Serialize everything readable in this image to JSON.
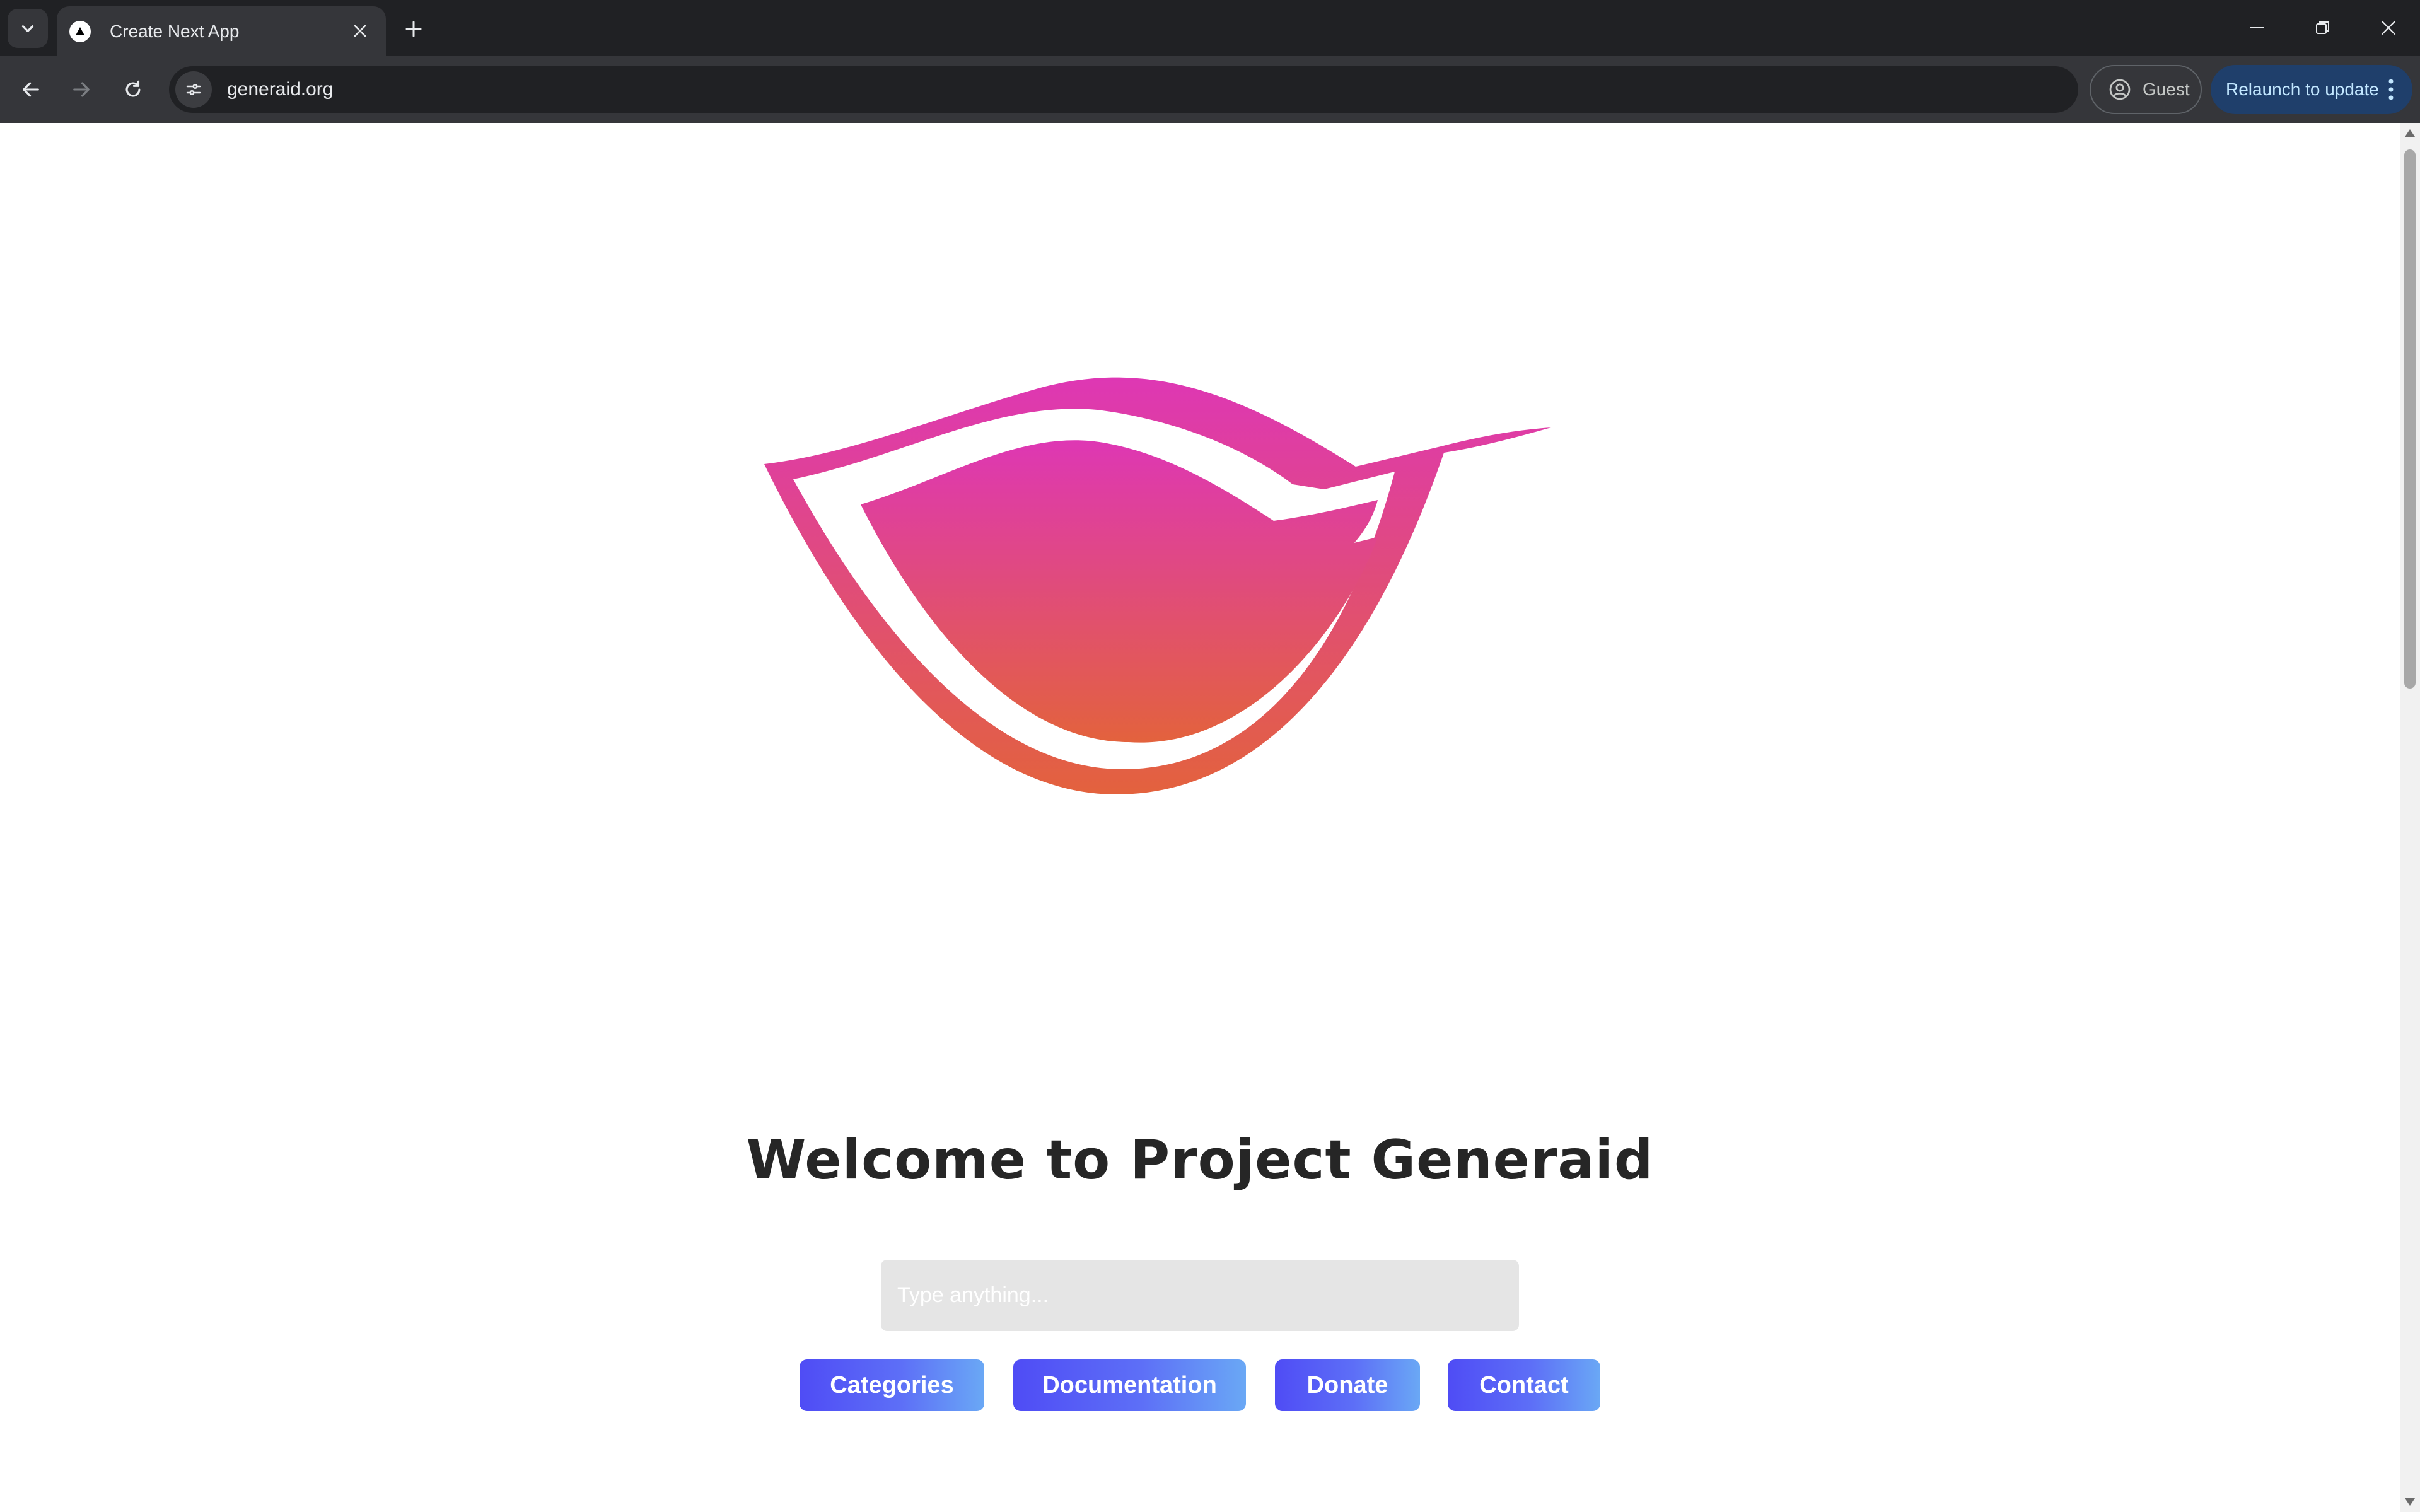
{
  "browser": {
    "tab_title": "Create Next App",
    "url": "generaid.org",
    "profile_label": "Guest",
    "update_label": "Relaunch to update",
    "icons": {
      "tab_list": "chevron-down-icon",
      "favicon": "nextjs-triangle-icon",
      "tab_close": "close-icon",
      "new_tab": "plus-icon",
      "minimize": "minimize-icon",
      "restore": "restore-icon",
      "close_window": "close-icon",
      "back": "arrow-left-icon",
      "forward": "arrow-right-icon",
      "reload": "reload-icon",
      "site_info": "tune-icon",
      "profile": "person-circle-icon",
      "menu": "kebab-menu-icon"
    }
  },
  "page": {
    "logo_icon": "leaf-logo-icon",
    "logo_colors": {
      "top": "#de37b4",
      "bottom": "#e3623d"
    },
    "title": "Welcome to Project Generaid",
    "search_placeholder": "Type anything...",
    "buttons": {
      "categories": "Categories",
      "documentation": "Documentation",
      "donate": "Donate",
      "contact": "Contact"
    },
    "button_gradient": {
      "start": "#4f4cf5",
      "end": "#6aa8f5"
    }
  }
}
